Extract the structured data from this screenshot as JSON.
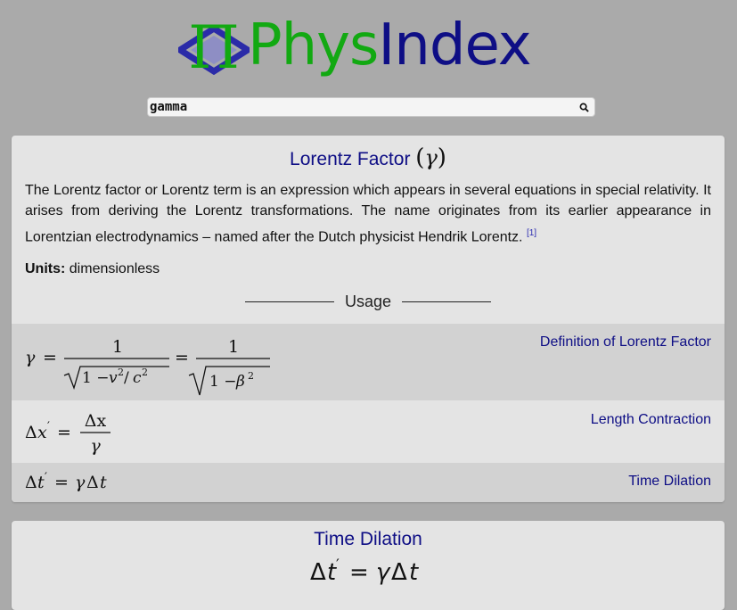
{
  "header": {
    "logo_part1": "Phys",
    "logo_part2": "Index",
    "logo_symbol": "Π"
  },
  "search": {
    "value": "gamma",
    "icon": "search-icon"
  },
  "card1": {
    "title": "Lorentz Factor",
    "symbol": "γ",
    "description": "The Lorentz factor or Lorentz term is an expression which appears in several equations in special relativity. It arises from deriving the Lorentz transformations. The name originates from its earlier appearance in Lorentzian electrodynamics – named after the Dutch physicist Hendrik Lorentz.",
    "ref": "[1]",
    "units_label": "Units:",
    "units_value": "dimensionless",
    "usage_heading": "Usage",
    "usages": [
      {
        "link": "Definition of Lorentz Factor"
      },
      {
        "link": "Length Contraction"
      },
      {
        "link": "Time Dilation"
      }
    ]
  },
  "card2": {
    "title": "Time Dilation"
  },
  "colors": {
    "background": "#aaaaaa",
    "card": "#e4e4e4",
    "row_alt": "#d2d2d2",
    "link": "#0e0e85",
    "logo_green": "#12a912",
    "logo_blue": "#0e0e85"
  }
}
